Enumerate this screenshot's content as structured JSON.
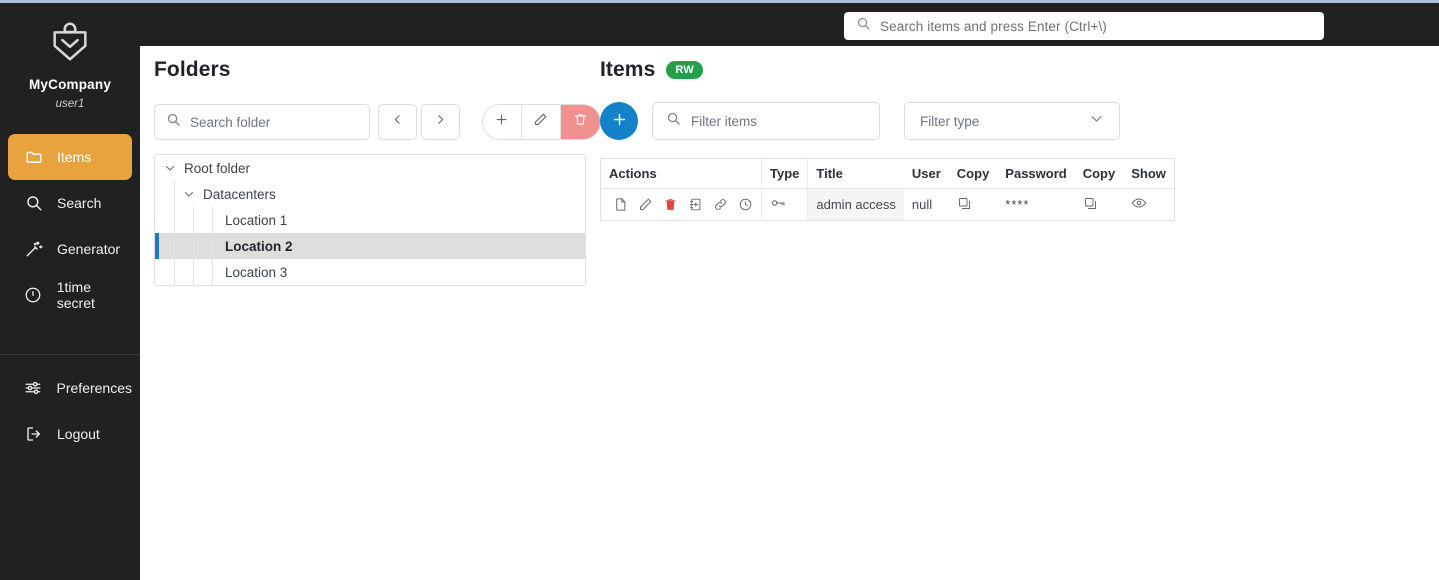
{
  "topbar": {
    "search": {
      "placeholder": "Search items and press Enter (Ctrl+\\)",
      "value": "",
      "icon": "search-icon"
    }
  },
  "sidebar": {
    "brand_name": "MyCompany",
    "user": "user1",
    "logo_icon": "shield-lock-logo",
    "items": [
      {
        "label": "Items",
        "icon": "folder-icon",
        "active": true
      },
      {
        "label": "Search",
        "icon": "search-icon",
        "active": false
      },
      {
        "label": "Generator",
        "icon": "magic-wand-icon",
        "active": false
      },
      {
        "label": "1time secret",
        "icon": "clock-circle-icon",
        "active": false
      }
    ],
    "bottom_items": [
      {
        "label": "Preferences",
        "icon": "sliders-icon",
        "active": false
      },
      {
        "label": "Logout",
        "icon": "logout-icon",
        "active": false
      }
    ],
    "active_bg": "#e8a33d",
    "bg": "#212121"
  },
  "folders": {
    "title": "Folders",
    "search": {
      "placeholder": "Search folder",
      "value": "",
      "icon": "search-icon"
    },
    "nav_prev_icon": "chevron-left-icon",
    "nav_next_icon": "chevron-right-icon",
    "actions": [
      {
        "name": "add-folder",
        "icon": "plus-icon",
        "danger": false
      },
      {
        "name": "edit-folder",
        "icon": "pencil-icon",
        "danger": false
      },
      {
        "name": "delete-folder",
        "icon": "trash-icon",
        "danger": true
      }
    ],
    "delete_color": "#f0918f",
    "selection_color": "#1a7cc0",
    "tree": [
      {
        "label": "Root folder",
        "depth": 0,
        "expanded": true,
        "has_chevron": true,
        "selected": false
      },
      {
        "label": "Datacenters",
        "depth": 1,
        "expanded": true,
        "has_chevron": true,
        "selected": false
      },
      {
        "label": "Location 1",
        "depth": 2,
        "expanded": false,
        "has_chevron": false,
        "selected": false
      },
      {
        "label": "Location 2",
        "depth": 2,
        "expanded": false,
        "has_chevron": false,
        "selected": true
      },
      {
        "label": "Location 3",
        "depth": 2,
        "expanded": false,
        "has_chevron": false,
        "selected": false
      }
    ]
  },
  "items": {
    "title": "Items",
    "badge": "RW",
    "badge_color": "#22a04a",
    "add_label": "+",
    "add_color": "#1482c8",
    "filter": {
      "placeholder": "Filter items",
      "value": "",
      "icon": "search-icon"
    },
    "type_filter": {
      "placeholder": "Filter type",
      "value": "",
      "icon": "chevron-down-icon"
    },
    "table": {
      "columns": [
        "Actions",
        "Type",
        "Title",
        "User",
        "Copy",
        "Password",
        "Copy",
        "Show"
      ],
      "rows": [
        {
          "actions": [
            {
              "name": "view-item",
              "icon": "file-icon",
              "danger": false
            },
            {
              "name": "edit-item",
              "icon": "pencil-icon",
              "danger": false
            },
            {
              "name": "delete-item",
              "icon": "trash-icon",
              "danger": true
            },
            {
              "name": "move-item",
              "icon": "move-to-folder-icon",
              "danger": false
            },
            {
              "name": "link-item",
              "icon": "link-icon",
              "danger": false
            },
            {
              "name": "history-item",
              "icon": "clock-icon",
              "danger": false
            }
          ],
          "type_icon": "key-icon",
          "title": "admin access",
          "user": "null",
          "copy_user_icon": "copy-icon",
          "password": "****",
          "copy_password_icon": "copy-icon",
          "show_icon": "eye-icon"
        }
      ]
    }
  }
}
